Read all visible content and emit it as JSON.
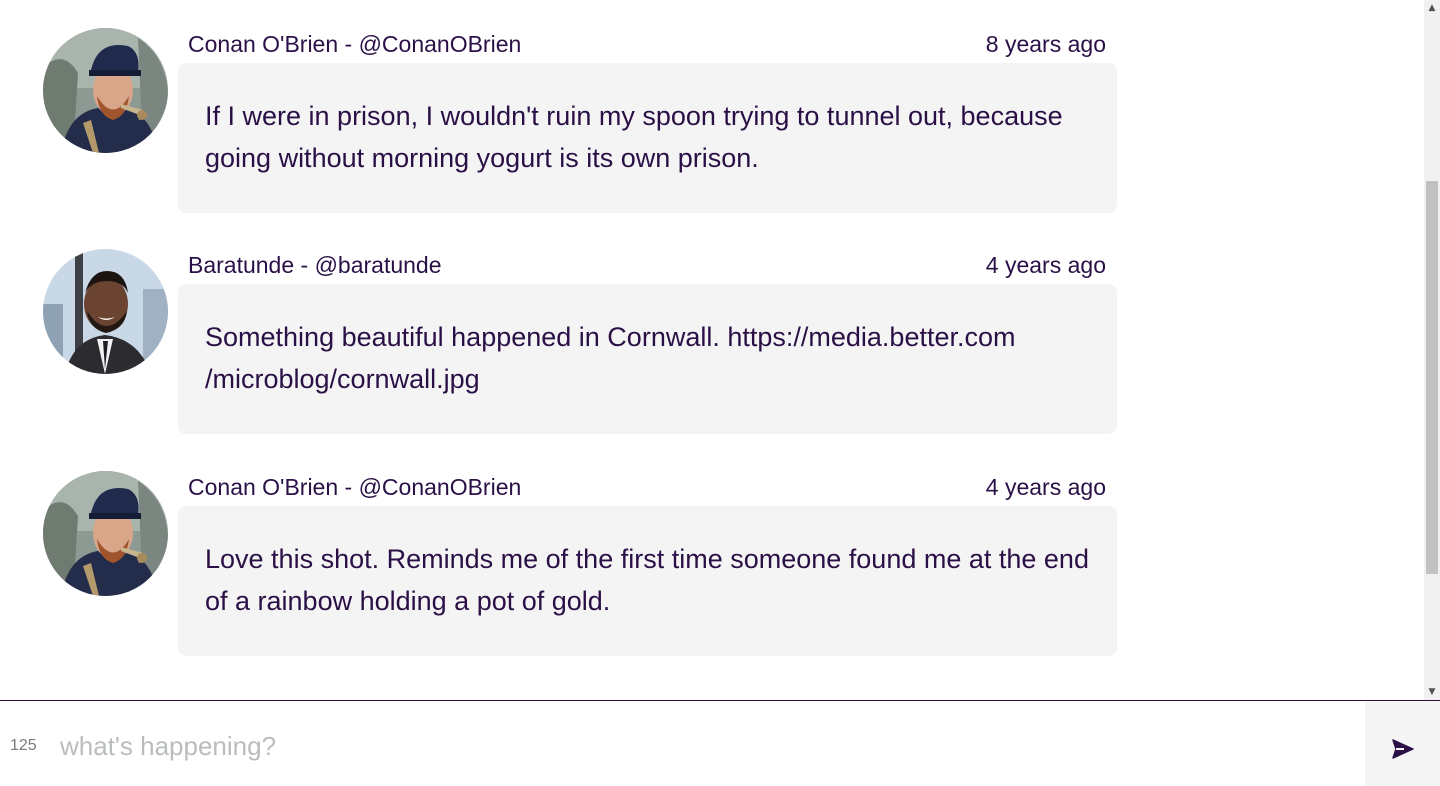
{
  "posts": [
    {
      "author": "Conan O'Brien - @ConanOBrien",
      "time": "8 years ago",
      "text": "If I were in prison, I wouldn't ruin my spoon trying to tunnel out, because going without morning yogurt is its own prison.",
      "avatar": "conan-avatar"
    },
    {
      "author": "Baratunde - @baratunde",
      "time": "4 years ago",
      "text": "Something beautiful happened in Cornwall. https://media.better.com /microblog/cornwall.jpg",
      "avatar": "baratunde-avatar"
    },
    {
      "author": "Conan O'Brien - @ConanOBrien",
      "time": "4 years ago",
      "text": "Love this shot. Reminds me of the first time someone found me at the end of a rainbow holding a pot of gold.",
      "avatar": "conan-avatar"
    }
  ],
  "composer": {
    "char_count": "125",
    "placeholder": "what's happening?",
    "send_icon": "send-icon"
  },
  "colors": {
    "text": "#2a1046",
    "bubble": "#f4f4f4",
    "placeholder": "#b9bdbd"
  }
}
